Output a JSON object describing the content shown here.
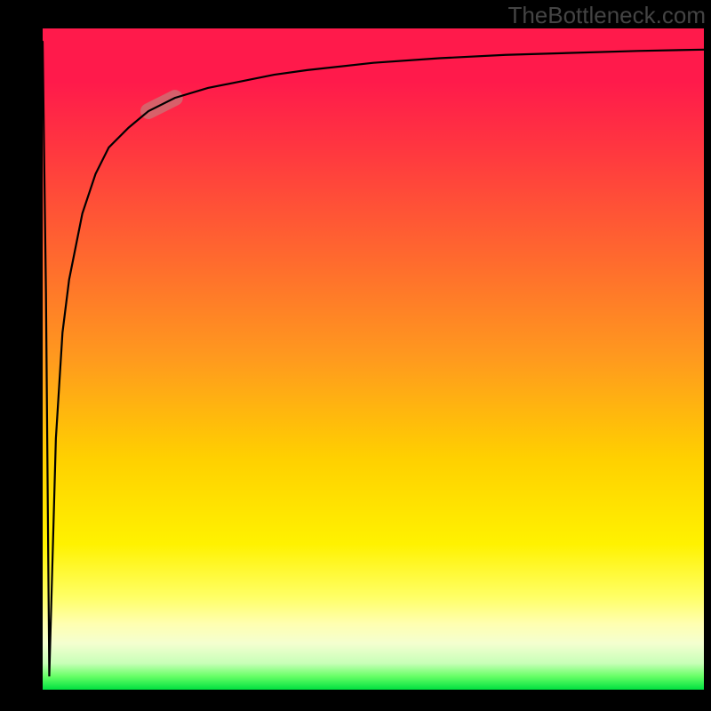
{
  "watermark": "TheBottleneck.com",
  "colors": {
    "gradient_top": "#ff1a4b",
    "gradient_mid1": "#ff9a1e",
    "gradient_mid2": "#fff200",
    "gradient_bottom": "#00e040",
    "curve": "#000000",
    "highlight": "rgba(200,120,120,0.72)",
    "frame": "#000000"
  },
  "chart_data": {
    "type": "line",
    "title": "",
    "xlabel": "",
    "ylabel": "",
    "xlim": [
      0,
      100
    ],
    "ylim": [
      0,
      100
    ],
    "x": [
      0,
      0.5,
      1,
      2,
      3,
      4,
      6,
      8,
      10,
      13,
      16,
      20,
      25,
      30,
      35,
      40,
      50,
      60,
      70,
      80,
      90,
      100
    ],
    "values": [
      98,
      60,
      2,
      38,
      54,
      62,
      72,
      78,
      82,
      85,
      87.5,
      89.5,
      91,
      92,
      93,
      93.7,
      94.8,
      95.5,
      96,
      96.3,
      96.6,
      96.8
    ],
    "highlight_range_x": [
      16,
      24
    ],
    "notes": "Curve plunges from near-top at x≈0 to near-bottom by x≈1, then rises steeply and asymptotes toward ~97%. A pink overlay marks the segment around x=16–24."
  }
}
